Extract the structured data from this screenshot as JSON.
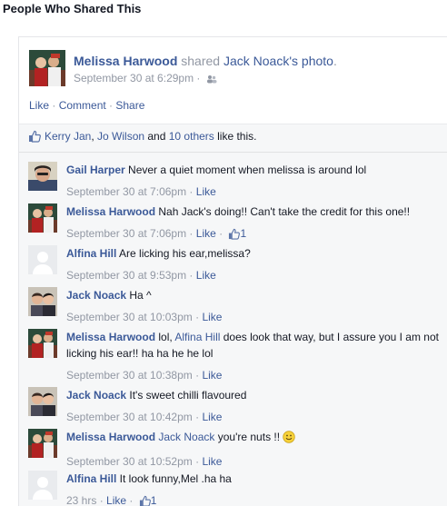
{
  "page": {
    "title": "People Who Shared This"
  },
  "post": {
    "author": "Melissa Harwood",
    "verb": "shared",
    "owner": "Jack Noack",
    "possessive": "'s",
    "object": "photo",
    "period": ".",
    "time": "September 30 at 6:29pm",
    "dot": " · ",
    "privacy_icon": "friends-icon",
    "actions": {
      "like": "Like",
      "comment": "Comment",
      "share": "Share",
      "sep": " · "
    }
  },
  "likes": {
    "icon": "thumbs-up-icon",
    "name1": "Kerry Jan",
    "comma": ", ",
    "name2": "Jo Wilson",
    "and": " and ",
    "others": "10 others",
    "suffix": " like this."
  },
  "comments": [
    {
      "author": "Gail Harper",
      "text": " Never a quiet moment when melissa is around lol",
      "time": "September 30 at 7:06pm",
      "dot": " · ",
      "like": "Like",
      "count": "",
      "avatar": "photo-gail"
    },
    {
      "author": "Melissa Harwood",
      "text": " Nah Jack's doing!! Can't take the credit for this one!!",
      "time": "September 30 at 7:06pm",
      "dot": " · ",
      "like": "Like",
      "dot2": " · ",
      "count": "1",
      "avatar": "photo-melissa"
    },
    {
      "author": "Alfina Hill",
      "text": " Are licking his ear,melissa?",
      "time": "September 30 at 9:53pm",
      "dot": " · ",
      "like": "Like",
      "count": "",
      "avatar": "silhouette"
    },
    {
      "author": "Jack Noack",
      "text": " Ha ^",
      "time": "September 30 at 10:03pm",
      "dot": " · ",
      "like": "Like",
      "count": "",
      "avatar": "photo-jack"
    },
    {
      "author": "Melissa Harwood",
      "text_pre": " lol, ",
      "mention": "Alfina Hill",
      "text_post": " does look that way, but I assure you I am not licking his ear!! ha ha he he lol",
      "time": "September 30 at 10:38pm",
      "dot": " · ",
      "like": "Like",
      "count": "",
      "avatar": "photo-melissa"
    },
    {
      "author": "Jack Noack",
      "text": " It's sweet chilli flavoured",
      "time": "September 30 at 10:42pm",
      "dot": " · ",
      "like": "Like",
      "count": "",
      "avatar": "photo-jack"
    },
    {
      "author": "Melissa Harwood",
      "mention": "Jack Noack",
      "text_post": " you're nuts !! ",
      "emoji": "smiley-emoji",
      "time": "September 30 at 10:52pm",
      "dot": " · ",
      "like": "Like",
      "count": "",
      "avatar": "photo-melissa"
    },
    {
      "author": "Alfina Hill",
      "text": " It look funny,Mel .ha ha",
      "time": "23 hrs",
      "dot": " · ",
      "like": "Like",
      "dot2": " · ",
      "count": "1",
      "avatar": "silhouette"
    }
  ],
  "colors": {
    "link": "#3b5998",
    "muted": "#9197a3",
    "feedback_bg": "#f6f7f8"
  }
}
